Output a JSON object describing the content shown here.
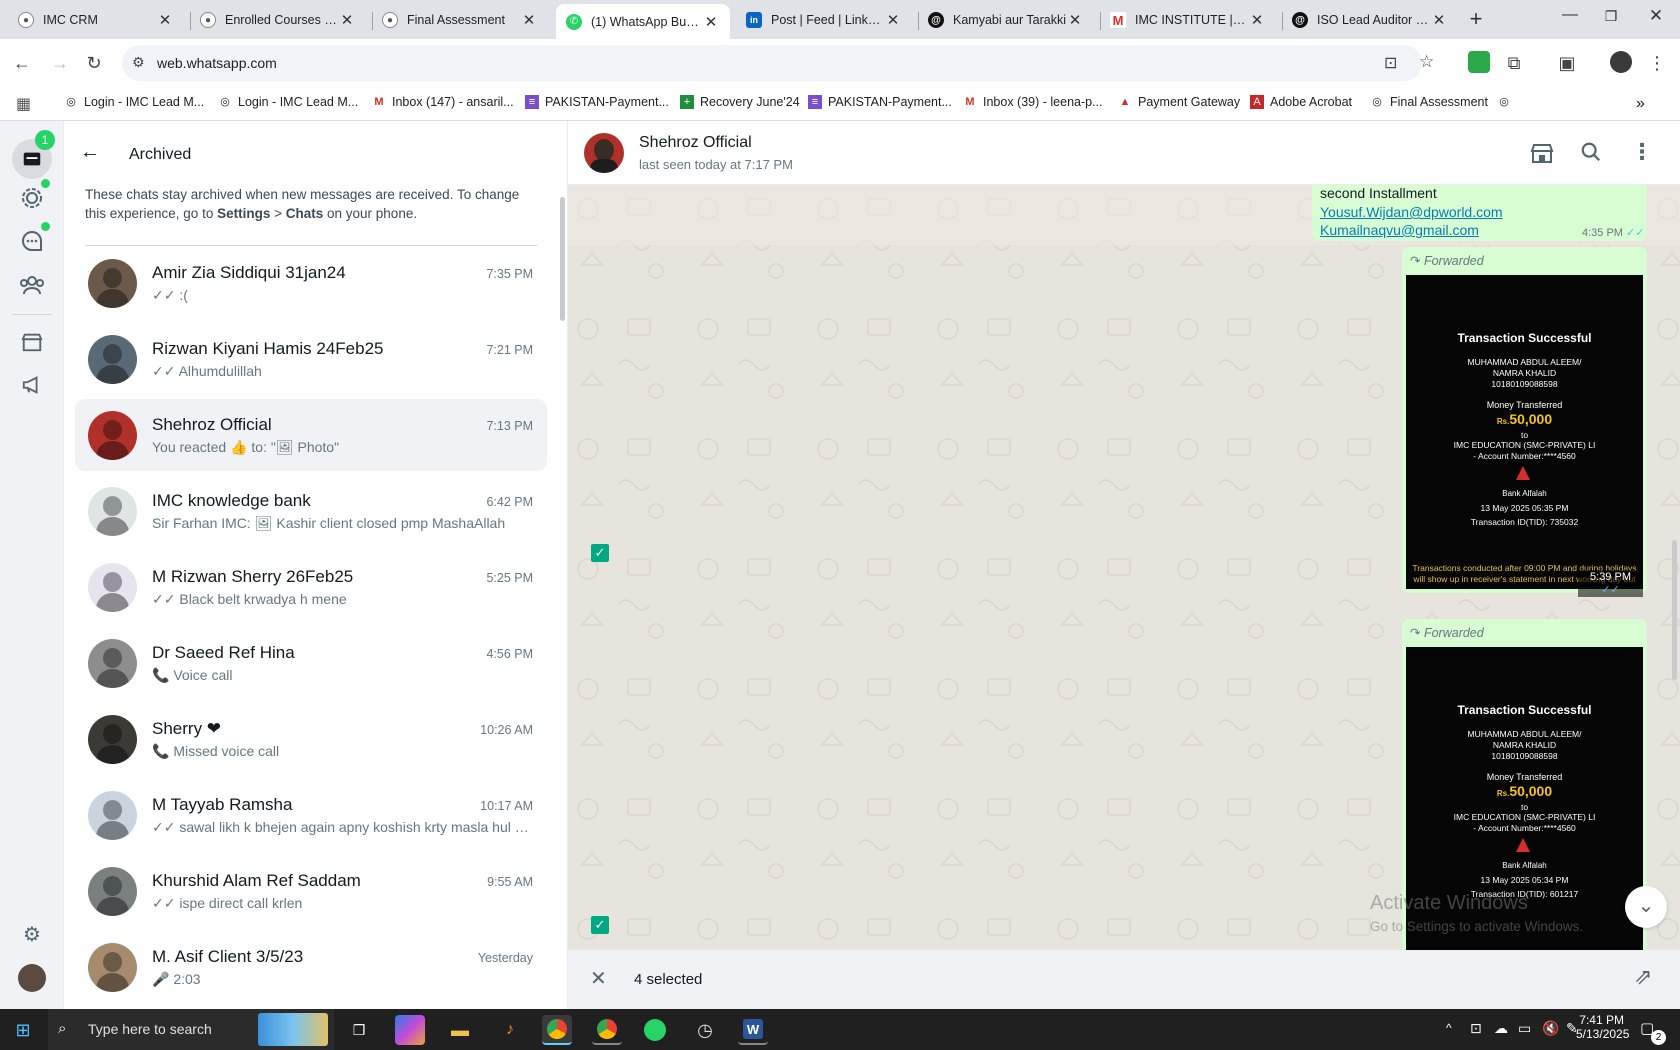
{
  "browser": {
    "tabs": [
      {
        "title": "IMC CRM",
        "icon": "imc-logo-icon"
      },
      {
        "title": "Enrolled Courses | IMC",
        "icon": "imc-logo-icon"
      },
      {
        "title": "Final Assessment",
        "icon": "imc-logo-icon"
      },
      {
        "title": "(1) WhatsApp Business",
        "icon": "whatsapp-icon",
        "active": true
      },
      {
        "title": "Post | Feed | LinkedIn",
        "icon": "linkedin-icon"
      },
      {
        "title": "Kamyabi aur Tarakki",
        "icon": "threads-icon"
      },
      {
        "title": "IMC INSTITUTE | ENROLL",
        "icon": "gmail-icon"
      },
      {
        "title": "ISO Lead Auditor in P",
        "icon": "threads-icon"
      }
    ],
    "url": "web.whatsapp.com",
    "bookmarks": [
      "Login - IMC Lead M...",
      "Login - IMC Lead M...",
      "Inbox (147) - ansaril...",
      "PAKISTAN-Payment...",
      "Recovery June'24",
      "PAKISTAN-Payment...",
      "Inbox (39) - leena-p...",
      "Payment Gateway",
      "Adobe Acrobat",
      "Final Assessment"
    ]
  },
  "whatsapp": {
    "rail": {
      "unread_badge": "1"
    },
    "archived": {
      "title": "Archived",
      "info_part1": "These chats stay archived when new messages are received. To change this experience, go to ",
      "info_settings": "Settings",
      "info_sep": " > ",
      "info_chats": "Chats",
      "info_part2": " on your phone.",
      "chats": [
        {
          "name": "Amir Zia Siddiqui 31jan24",
          "time": "7:35 PM",
          "preview": "✓✓ :(",
          "avatar_color": "#6b5a4a"
        },
        {
          "name": "Rizwan Kiyani Hamis 24Feb25",
          "time": "7:21 PM",
          "preview": "✓✓ Alhumdulillah",
          "avatar_color": "#5a6a74"
        },
        {
          "name": "Shehroz Official",
          "time": "7:13 PM",
          "preview": "You reacted 👍 to: \"🖼 Photo\"",
          "avatar_color": "#b0302a"
        },
        {
          "name": "IMC knowledge bank",
          "time": "6:42 PM",
          "preview": "Sir Farhan IMC: 🖼 Kashir client closed pmp MashaAllah",
          "avatar_color": "#dfe5e7"
        },
        {
          "name": "M Rizwan Sherry 26Feb25",
          "time": "5:25 PM",
          "preview": "✓✓ Black belt krwadya h mene",
          "avatar_color": "#e8e4ef"
        },
        {
          "name": "Dr Saeed Ref Hina",
          "time": "4:56 PM",
          "preview": "📞 Voice call",
          "avatar_color": "#8d8d8d"
        },
        {
          "name": "Sherry ❤",
          "time": "10:26 AM",
          "preview": "📞 Missed voice call",
          "avatar_color": "#3d3a36"
        },
        {
          "name": "M Tayyab Ramsha",
          "time": "10:17 AM",
          "preview": "✓✓ sawal likh k bhejen again apny koshish krty masla hul kr...",
          "avatar_color": "#c9d4dc"
        },
        {
          "name": "Khurshid Alam Ref Saddam",
          "time": "9:55 AM",
          "preview": "✓✓ ispe direct call krlen",
          "avatar_color": "#7a7f80"
        },
        {
          "name": "M. Asif Client 3/5/23",
          "time": "Yesterday",
          "preview": "🎤 2:03",
          "avatar_color": "#a68b6f"
        }
      ]
    },
    "conversation": {
      "contact_name": "Shehroz Official",
      "last_seen": "last seen today at 7:17 PM",
      "top_bubble": {
        "line1": "second Installment",
        "email1": "Yousuf.Wijdan@dpworld.com",
        "email2": "Kumailnaqvu@gmail.com",
        "time": "4:35 PM"
      },
      "forwarded_label": "Forwarded",
      "receipts": [
        {
          "heading": "Transaction Successful",
          "name1": "MUHAMMAD ABDUL ALEEM/",
          "name2": "NAMRA KHALID",
          "account": "10180109088598",
          "transferred": "Money Transferred",
          "currency": "Rs.",
          "amount": "50,000",
          "to": "to",
          "beneficiary": "IMC EDUCATION (SMC-PRIVATE) LI",
          "acct_no": "- Account Number:****4560",
          "bank": "Bank Alfalah",
          "datetime": "13 May 2025  05:35 PM",
          "tid": "Transaction ID(TID): 735032",
          "notice": "Transactions conducted after 09:00 PM and during holidays will show up in receiver's statement in next working day but balance will be updated",
          "time": "5:39 PM"
        },
        {
          "heading": "Transaction Successful",
          "name1": "MUHAMMAD ABDUL ALEEM/",
          "name2": "NAMRA KHALID",
          "account": "10180109088598",
          "transferred": "Money Transferred",
          "currency": "Rs.",
          "amount": "50,000",
          "to": "to",
          "beneficiary": "IMC EDUCATION (SMC-PRIVATE) LI",
          "acct_no": "- Account Number:****4560",
          "bank": "Bank Alfalah",
          "datetime": "13 May 2025  05:34 PM",
          "tid": "Transaction ID(TID): 601217"
        }
      ],
      "watermark_title": "Activate Windows",
      "watermark_sub": "Go to Settings to activate Windows.",
      "selected_count": "4 selected"
    }
  },
  "taskbar": {
    "search_placeholder": "Type here to search",
    "time": "7:41 PM",
    "date": "5/13/2025",
    "notification_count": "2"
  },
  "colors": {
    "wa_green": "#00a884",
    "bubble": "#d9fdd3",
    "amount_yellow": "#f5c518"
  }
}
